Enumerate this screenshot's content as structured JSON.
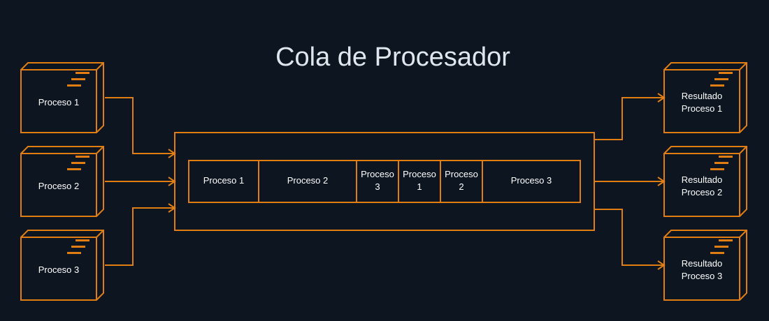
{
  "title": "Cola de Procesador",
  "colors": {
    "background": "#0d1520",
    "accent": "#e07e14",
    "text": "#ffffff",
    "title_text": "#dfe6ee"
  },
  "inputs": [
    {
      "label": [
        "Proceso 1"
      ]
    },
    {
      "label": [
        "Proceso 2"
      ]
    },
    {
      "label": [
        "Proceso 3"
      ]
    }
  ],
  "queue": {
    "slots": [
      {
        "label": [
          "Proceso 1"
        ]
      },
      {
        "label": [
          "Proceso 2"
        ]
      },
      {
        "label": [
          "Proceso",
          "3"
        ]
      },
      {
        "label": [
          "Proceso",
          "1"
        ]
      },
      {
        "label": [
          "Proceso",
          "2"
        ]
      },
      {
        "label": [
          "Proceso 3"
        ]
      }
    ]
  },
  "outputs": [
    {
      "label": [
        "Resultado",
        "Proceso 1"
      ]
    },
    {
      "label": [
        "Resultado",
        "Proceso 2"
      ]
    },
    {
      "label": [
        "Resultado",
        "Proceso 3"
      ]
    }
  ],
  "node_icon": "component-icon"
}
